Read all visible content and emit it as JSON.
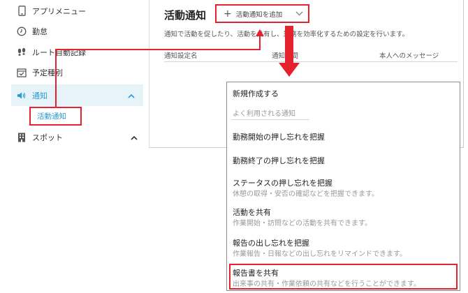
{
  "sidebar": {
    "items": [
      {
        "label": "アプリメニュー",
        "icon": "smartphone-icon"
      },
      {
        "label": "勤怠",
        "icon": "clock-icon"
      },
      {
        "label": "ルート自動記録",
        "icon": "footsteps-icon"
      },
      {
        "label": "予定種別",
        "icon": "calendar-check-icon"
      },
      {
        "label": "通知",
        "icon": "speaker-icon",
        "active": true
      },
      {
        "label": "スポット",
        "icon": "building-icon"
      }
    ],
    "sub_item": "活動通知"
  },
  "main": {
    "title": "活動通知",
    "add_button_label": "活動通知を追加",
    "description": "通知で活動を促したり、活動を共有し、業務を効率化するための設定を行います。",
    "columns": [
      "通知設定名",
      "通知時間",
      "本人へのメッセージ"
    ]
  },
  "menu": {
    "create_new": "新規作成する",
    "search_placeholder": "よく利用される通知",
    "options": [
      {
        "title": "勤務開始の押し忘れを把握",
        "subtitle": ""
      },
      {
        "title": "勤務終了の押し忘れを把握",
        "subtitle": ""
      },
      {
        "title": "ステータスの押し忘れを把握",
        "subtitle": "休憩の取得・安否の確認などを把握できます。"
      },
      {
        "title": "活動を共有",
        "subtitle": "作業開始・訪問などの活動を共有できます。"
      },
      {
        "title": "報告の出し忘れを把握",
        "subtitle": "作業報告・日報などの出し忘れをリマインドできます。"
      },
      {
        "title": "報告書を共有",
        "subtitle": "出来事の共有・作業依頼の共有などを行うことができます。"
      }
    ]
  },
  "colors": {
    "accent": "#2a9bd2",
    "annotation_red": "#e5212e",
    "active_bg": "#e6f3f9"
  }
}
